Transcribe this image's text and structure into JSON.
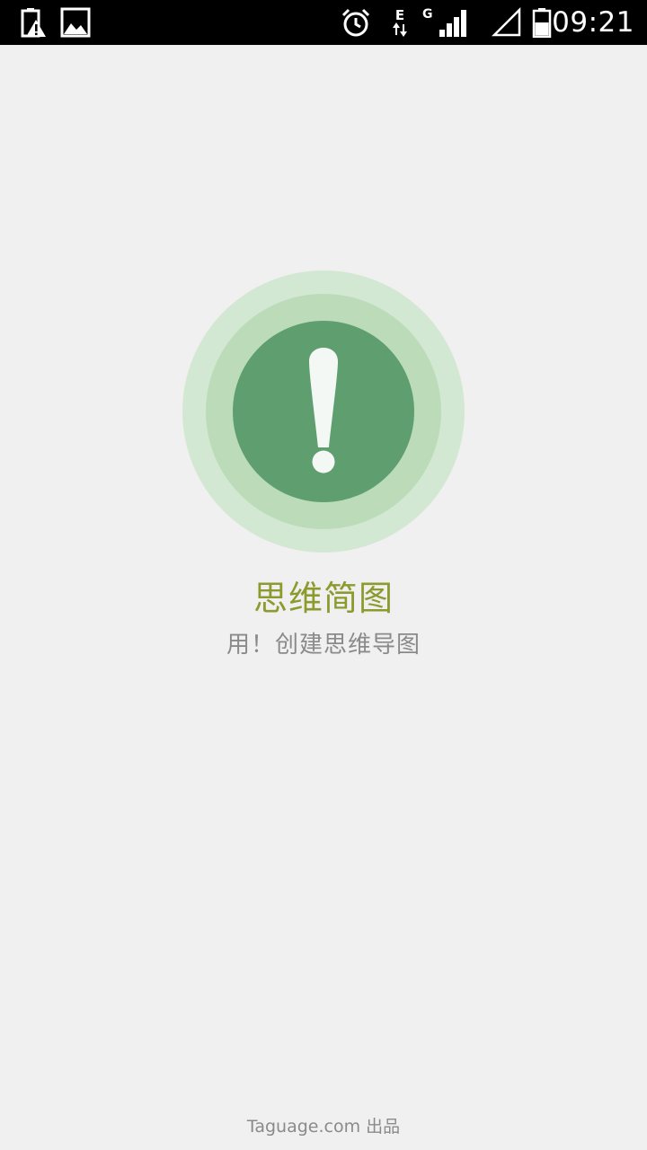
{
  "status_bar": {
    "time": "09:21",
    "network_label": "E",
    "signal_label": "G",
    "icons": [
      "battery-warning-icon",
      "image-notification-icon",
      "alarm-icon",
      "data-transfer-icon",
      "cell-signal-icon",
      "wifi-signal-empty-icon",
      "battery-icon"
    ]
  },
  "splash": {
    "emblem_icon": "exclamation-icon",
    "colors": {
      "outer_ring": "#d3e8d2",
      "middle_ring": "#bcdcb9",
      "inner_circle": "#5f9f6f",
      "glyph": "#f4f8f4"
    },
    "title": "思维简图",
    "subtitle": "用！创建思维导图"
  },
  "footer": {
    "credit": "Taguage.com 出品"
  }
}
